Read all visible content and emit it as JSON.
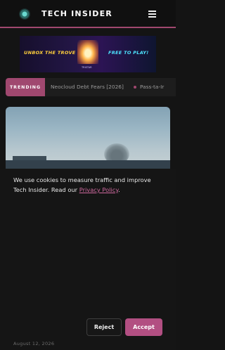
{
  "header": {
    "brand": "TECH INSIDER",
    "logo_icon": "logo-icon",
    "menu_icon": "hamburger-menu-icon"
  },
  "ad": {
    "left_text": "UNBOX THE TROVE",
    "right_text": "FREE TO PLAY!",
    "small_text": "TRISTAR"
  },
  "trending": {
    "label": "TRENDING",
    "items": [
      "Neocloud Debt Fears [2026]",
      "Pass-ta-Ir"
    ]
  },
  "article": {
    "date": "August 12, 2026"
  },
  "cookie": {
    "text_before": "We use cookies to measure traffic and improve Tech Insider. Read our ",
    "link": "Privacy Policy",
    "text_after": ".",
    "reject": "Reject",
    "accept": "Accept"
  },
  "colors": {
    "accent": "#a0486f",
    "background": "#141414",
    "accept": "#b24f82"
  }
}
